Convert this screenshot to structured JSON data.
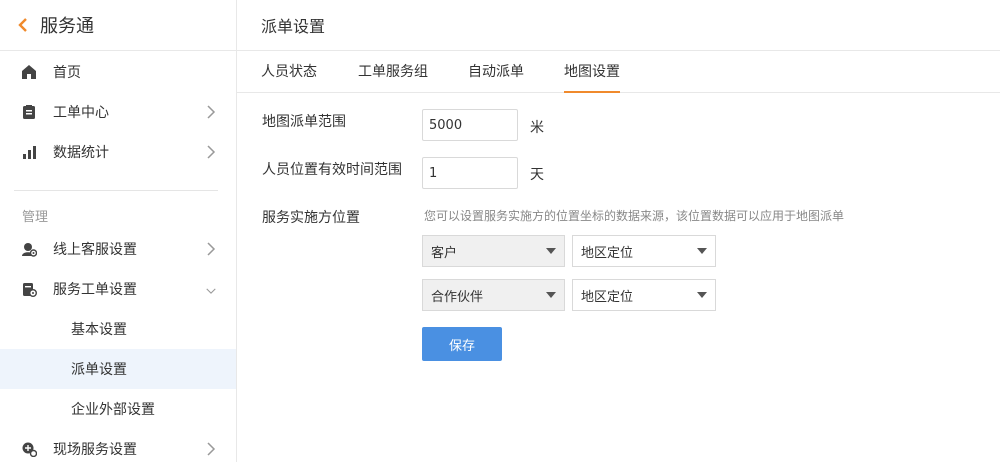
{
  "sidebar": {
    "title": "服务通",
    "items": [
      {
        "label": "首页",
        "icon": "home-icon"
      },
      {
        "label": "工单中心",
        "icon": "clipboard-icon"
      },
      {
        "label": "数据统计",
        "icon": "bar-chart-icon"
      }
    ],
    "section_label": "管理",
    "manage_items": [
      {
        "label": "线上客服设置",
        "icon": "customer-service-icon"
      },
      {
        "label": "服务工单设置",
        "icon": "ticket-settings-icon"
      }
    ],
    "sub_items": [
      {
        "label": "基本设置"
      },
      {
        "label": "派单设置"
      },
      {
        "label": "企业外部设置"
      }
    ],
    "more_items": [
      {
        "label": "现场服务设置",
        "icon": "onsite-service-icon"
      }
    ],
    "active_sub": "派单设置"
  },
  "page": {
    "title": "派单设置",
    "tabs": [
      {
        "label": "人员状态"
      },
      {
        "label": "工单服务组"
      },
      {
        "label": "自动派单"
      },
      {
        "label": "地图设置"
      }
    ],
    "active_tab": "地图设置"
  },
  "form": {
    "range_label": "地图派单范围",
    "range_value": "5000",
    "range_unit": "米",
    "valid_label": "人员位置有效时间范围",
    "valid_value": "1",
    "valid_unit": "天",
    "provider_label": "服务实施方位置",
    "provider_hint": "您可以设置服务实施方的位置坐标的数据来源，该位置数据可以应用于地图派单",
    "rows": [
      {
        "party": "客户",
        "source": "地区定位"
      },
      {
        "party": "合作伙伴",
        "source": "地区定位"
      }
    ],
    "save_label": "保存"
  },
  "colors": {
    "accent": "#f08a2c",
    "primary": "#4a90e2",
    "active_bg": "#eef4fc"
  }
}
